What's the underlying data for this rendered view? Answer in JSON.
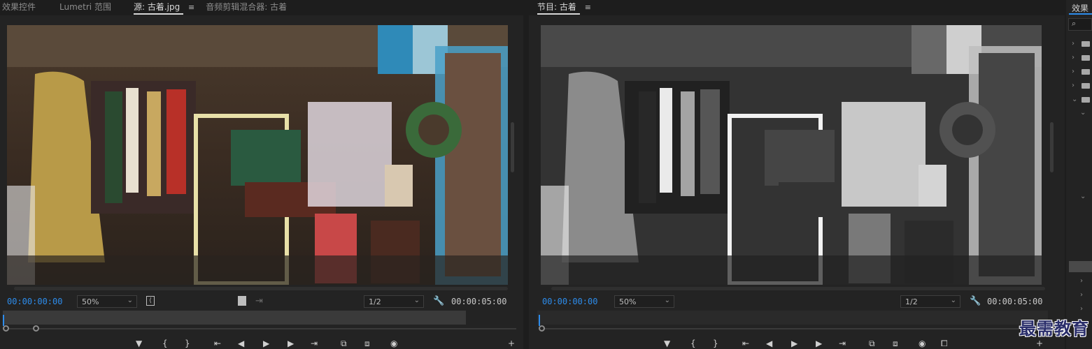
{
  "source_panel": {
    "tabs": [
      {
        "label": "效果控件"
      },
      {
        "label": "Lumetri 范围"
      },
      {
        "label": "源: 古着.jpg"
      },
      {
        "label": "音频剪辑混合器: 古着"
      }
    ],
    "menu_glyph": "≡",
    "current_time": "00:00:00:00",
    "zoom": "50%",
    "resolution": "1/2",
    "duration": "00:00:05:00"
  },
  "program_panel": {
    "tab_label": "节目: 古着",
    "menu_glyph": "≡",
    "current_time": "00:00:00:00",
    "zoom": "50%",
    "resolution": "1/2",
    "duration": "00:00:05:00"
  },
  "effects_panel": {
    "title": "效果",
    "search_glyph": "⌕"
  },
  "watermark": "最需教育",
  "colors": {
    "accent": "#2d8ceb",
    "panel_bg": "#232323",
    "tab_bg": "#1d1d1d"
  },
  "icons": {
    "mark_in": "mark-in-icon",
    "mark_out": "mark-out-icon",
    "play": "play-icon",
    "settings": "wrench-icon",
    "export_frame": "camera-icon",
    "add": "plus-icon"
  }
}
